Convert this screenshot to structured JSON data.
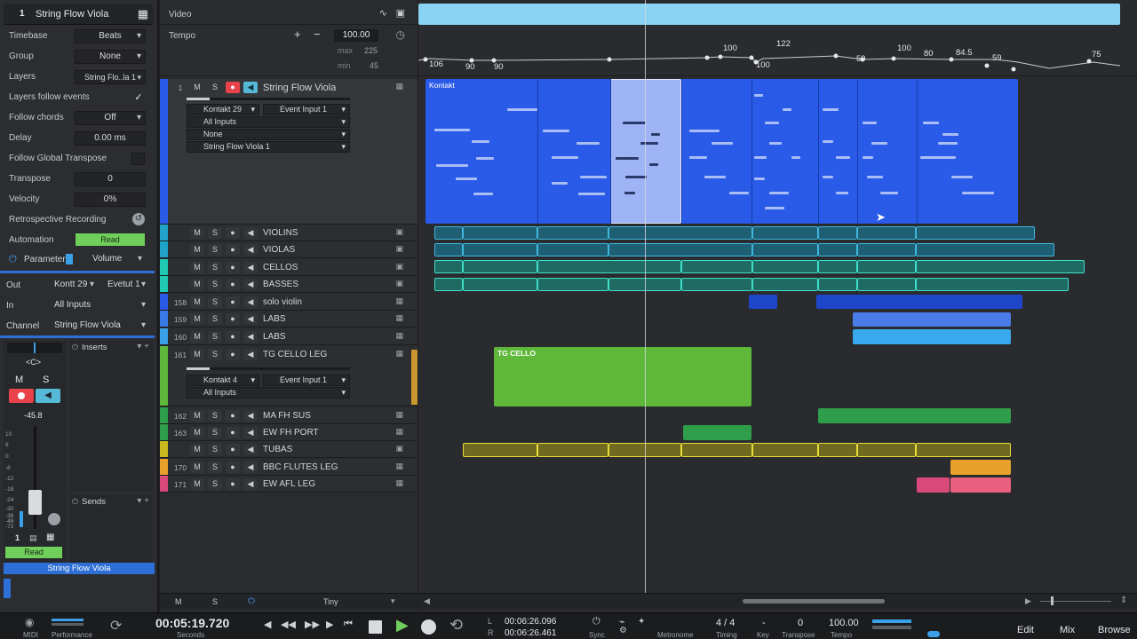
{
  "inspector": {
    "track_number": "1",
    "track_title": "String Flow Viola",
    "rows": [
      {
        "label": "Timebase",
        "value": "Beats"
      },
      {
        "label": "Group",
        "value": "None"
      },
      {
        "label": "Layers",
        "value": "String Flo..la 1"
      },
      {
        "label": "Layers follow events",
        "value": "✓"
      },
      {
        "label": "Follow chords",
        "value": "Off"
      },
      {
        "label": "Delay",
        "value": "0.00 ms"
      },
      {
        "label": "Follow Global Transpose",
        "value": ""
      },
      {
        "label": "Transpose",
        "value": "0"
      },
      {
        "label": "Velocity",
        "value": "0%"
      },
      {
        "label": "Retrospective Recording",
        "value": ""
      },
      {
        "label": "Automation",
        "value": "Read"
      }
    ],
    "parameter_label": "Parameter",
    "parameter_value": "Volume",
    "out_label": "Out",
    "out_value_1": "Kontt 29",
    "out_value_2": "Evetut 1",
    "in_label": "In",
    "in_value": "All Inputs",
    "channel_label": "Channel",
    "channel_value": "String Flow Viola",
    "pan_value": "<C>",
    "mute_label": "M",
    "solo_label": "S",
    "volume_db": "-45.8",
    "meter_scale": [
      "10",
      "6",
      "0",
      "-6",
      "-12",
      "-18",
      "-24",
      "-30",
      "-36",
      "-48",
      "-72"
    ],
    "inserts_label": "Inserts",
    "sends_label": "Sends",
    "channel_number": "1",
    "automation_mode": "Read",
    "channel_name_footer": "String Flow Viola",
    "accent_color": "#2d6fd6",
    "read_color": "#6fcf5a"
  },
  "global_tracks": {
    "video_label": "Video",
    "tempo_label": "Tempo",
    "tempo_value": "100.00",
    "tempo_max_label": "max",
    "tempo_max": "225",
    "tempo_min_label": "min",
    "tempo_min": "45",
    "tempo_points": [
      "106",
      "90",
      "90",
      "100",
      "100",
      "122",
      "59",
      "100",
      "80",
      "84.5",
      "59",
      "75"
    ]
  },
  "tracks": [
    {
      "num": "1",
      "mute": "M",
      "solo": "S",
      "name": "String Flow Viola",
      "color": "#2a5ae8",
      "sub": [
        "Kontakt 29",
        "Event Input 1",
        "All Inputs",
        "None",
        "String Flow Viola 1"
      ]
    },
    {
      "num": "",
      "mute": "M",
      "solo": "S",
      "name": "VIOLINS",
      "color": "#1fa3c9"
    },
    {
      "num": "",
      "mute": "M",
      "solo": "S",
      "name": "VIOLAS",
      "color": "#1fa3c9"
    },
    {
      "num": "",
      "mute": "M",
      "solo": "S",
      "name": "CELLOS",
      "color": "#1fc9b3"
    },
    {
      "num": "",
      "mute": "M",
      "solo": "S",
      "name": "BASSES",
      "color": "#1fc9b3"
    },
    {
      "num": "158",
      "mute": "M",
      "solo": "S",
      "name": "solo violin",
      "color": "#2a5ae8"
    },
    {
      "num": "159",
      "mute": "M",
      "solo": "S",
      "name": "LABS",
      "color": "#3a7ae8"
    },
    {
      "num": "160",
      "mute": "M",
      "solo": "S",
      "name": "LABS",
      "color": "#3aa0e8"
    },
    {
      "num": "161",
      "mute": "M",
      "solo": "S",
      "name": "TG CELLO LEG",
      "color": "#5fb83a",
      "sub": [
        "Kontakt 4",
        "Event Input 1",
        "All Inputs"
      ]
    },
    {
      "num": "162",
      "mute": "M",
      "solo": "S",
      "name": "MA FH SUS",
      "color": "#2f9e4a"
    },
    {
      "num": "163",
      "mute": "M",
      "solo": "S",
      "name": "EW FH PORT",
      "color": "#2f9e4a"
    },
    {
      "num": "",
      "mute": "M",
      "solo": "S",
      "name": "TUBAS",
      "color": "#c9b81f"
    },
    {
      "num": "170",
      "mute": "M",
      "solo": "S",
      "name": "BBC FLUTES LEG",
      "color": "#e8a12a"
    },
    {
      "num": "171",
      "mute": "M",
      "solo": "S",
      "name": "EW AFL LEG",
      "color": "#d94a7a"
    }
  ],
  "tracklist_footer": {
    "m": "M",
    "s": "S",
    "size": "Tiny"
  },
  "clips": {
    "kontakt_label": "Kontakt",
    "tg_cello_label": "TG CELLO"
  },
  "transport": {
    "midi_label": "MIDI",
    "performance_label": "Performance",
    "time": "00:05:19.720",
    "time_unit": "Seconds",
    "loop_l_label": "L",
    "loop_l": "00:06:26.096",
    "loop_r_label": "R",
    "loop_r": "00:06:26.461",
    "sync_label": "Sync",
    "metronome_label": "Metronome",
    "timing_label": "Timing",
    "timing_value": "4 / 4",
    "key_label": "Key",
    "key_value": "-",
    "transpose_label": "Transpose",
    "transpose_value": "0",
    "tempo_label": "Tempo",
    "tempo_value": "100.00",
    "edit_label": "Edit",
    "mix_label": "Mix",
    "browse_label": "Browse"
  }
}
